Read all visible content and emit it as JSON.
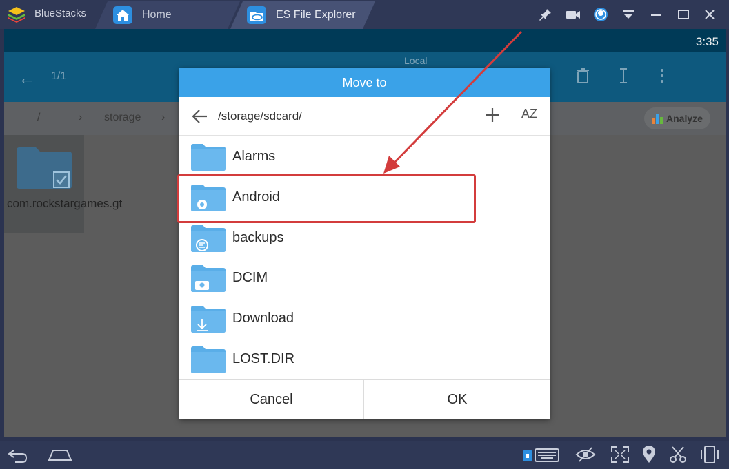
{
  "titlebar": {
    "app_name": "BlueStacks",
    "tabs": [
      {
        "label": "Home"
      },
      {
        "label": "ES File Explorer"
      }
    ]
  },
  "statusbar": {
    "time": "3:35"
  },
  "appbar": {
    "location_label": "Local",
    "selection_count": "1/1"
  },
  "pathbar": {
    "root": "/",
    "segment": "storage",
    "analyze_label": "Analyze"
  },
  "selected_item": {
    "label": "com.rockstargames.gt"
  },
  "dialog": {
    "title": "Move to",
    "path": "/storage/sdcard/",
    "sort_label": "AZ",
    "folders": [
      {
        "name": "Alarms",
        "badge": ""
      },
      {
        "name": "Android",
        "badge": "gear-icon"
      },
      {
        "name": "backups",
        "badge": "es-icon"
      },
      {
        "name": "DCIM",
        "badge": "camera-icon"
      },
      {
        "name": "Download",
        "badge": "download-icon"
      },
      {
        "name": "LOST.DIR",
        "badge": ""
      }
    ],
    "cancel_label": "Cancel",
    "ok_label": "OK"
  },
  "annotation": {
    "highlight_color": "#d33c3c",
    "highlighted_folder": "Android"
  },
  "colors": {
    "accent": "#3aa2e8",
    "folder": "#5aaee8",
    "appbar": "#0e597e"
  }
}
